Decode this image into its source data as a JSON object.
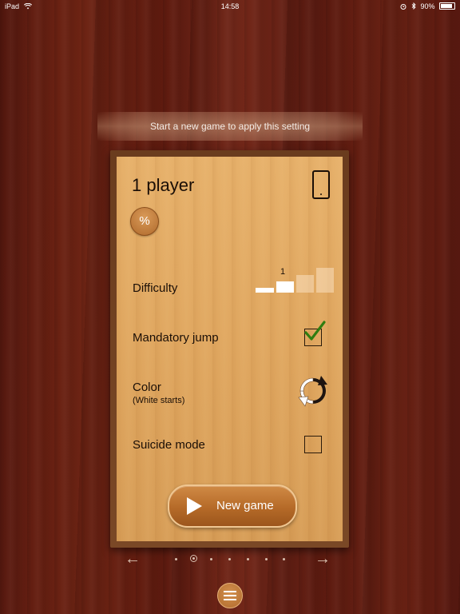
{
  "status_bar": {
    "device": "iPad",
    "time": "14:58",
    "battery": "90%",
    "wifi_icon": "wifi-icon",
    "alarm_icon": "alarm-icon",
    "bluetooth_icon": "bluetooth-icon"
  },
  "banner": {
    "text": "Start a new game to apply this setting"
  },
  "panel": {
    "title": "1 player",
    "device_icon": "tablet-icon",
    "percent_button": "%",
    "difficulty": {
      "label": "Difficulty",
      "level": "1",
      "levels_total": 4
    },
    "mandatory_jump": {
      "label": "Mandatory jump",
      "checked": true
    },
    "color": {
      "label": "Color",
      "sublabel": "(White starts)",
      "icon": "swap-color-icon"
    },
    "suicide_mode": {
      "label": "Suicide mode",
      "checked": false
    },
    "new_game_button": "New game"
  },
  "pager": {
    "pages": 7,
    "current": 2,
    "prev_icon": "arrow-left-icon",
    "next_icon": "arrow-right-icon"
  },
  "menu_button_icon": "menu-icon",
  "colors": {
    "wood_dark": "#5a1a10",
    "panel": "#e0a862",
    "button": "#b56a28",
    "check_green": "#2f7d10"
  }
}
